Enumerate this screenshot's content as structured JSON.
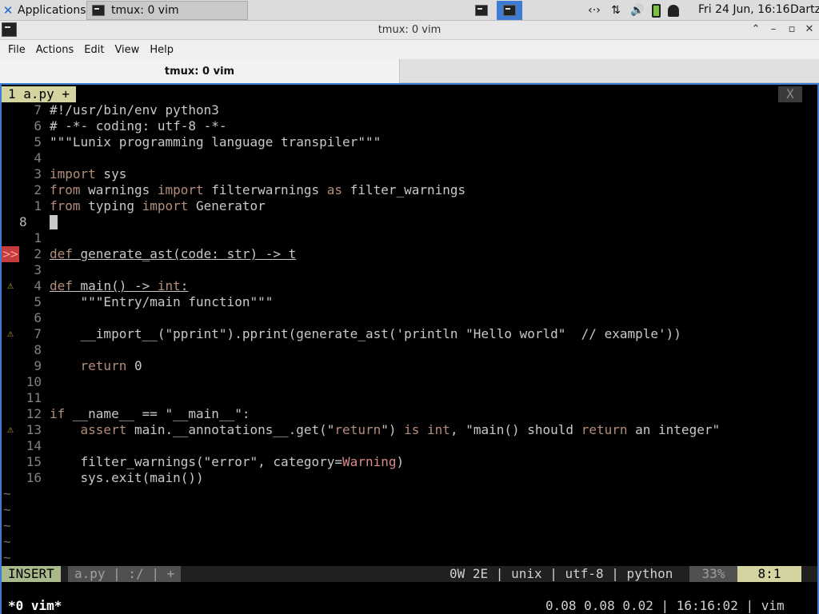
{
  "panel": {
    "apps_label": "Applications",
    "task_label": "tmux: 0 vim",
    "clock": "Fri 24 Jun, 16:16",
    "user": "Dartz",
    "tray_network_glyph": "‹·›",
    "tray_transfer_glyph": "⇅",
    "tray_volume_glyph": "🔊"
  },
  "window": {
    "title": "tmux: 0 vim",
    "min_glyph": "⌃",
    "restore_glyph": "–",
    "max_glyph": "▫",
    "close_glyph": "✕"
  },
  "menu": [
    "File",
    "Actions",
    "Edit",
    "View",
    "Help"
  ],
  "tab": {
    "label": "tmux: 0 vim"
  },
  "vim": {
    "buftab": "1 a.py +",
    "buftab_close": "X",
    "lines": [
      {
        "num": "7",
        "sign": "",
        "code": "#!/usr/bin/env python3"
      },
      {
        "num": "6",
        "sign": "",
        "code": "# -*- coding: utf-8 -*-"
      },
      {
        "num": "5",
        "sign": "",
        "code": "\"\"\"Lunix programming language transpiler\"\"\""
      },
      {
        "num": "4",
        "sign": "",
        "code": ""
      },
      {
        "num": "3",
        "sign": "",
        "code": "import sys"
      },
      {
        "num": "2",
        "sign": "",
        "code": "from warnings import filterwarnings as filter_warnings"
      },
      {
        "num": "1",
        "sign": "",
        "code": "from typing import Generator"
      },
      {
        "num": "8",
        "sign": "",
        "code": "",
        "current": true
      },
      {
        "num": "1",
        "sign": "",
        "code": ""
      },
      {
        "num": "2",
        "sign": ">>",
        "code": "def generate_ast(code: str) -> t"
      },
      {
        "num": "3",
        "sign": "",
        "code": ""
      },
      {
        "num": "4",
        "sign": "⚠",
        "code": "def main() -> int:"
      },
      {
        "num": "5",
        "sign": "",
        "code": "    \"\"\"Entry/main function\"\"\""
      },
      {
        "num": "6",
        "sign": "",
        "code": ""
      },
      {
        "num": "7",
        "sign": "⚠",
        "code": "    __import__(\"pprint\").pprint(generate_ast('println \"Hello world\"  // example'))"
      },
      {
        "num": "8",
        "sign": "",
        "code": ""
      },
      {
        "num": "9",
        "sign": "",
        "code": "    return 0"
      },
      {
        "num": "10",
        "sign": "",
        "code": ""
      },
      {
        "num": "11",
        "sign": "",
        "code": ""
      },
      {
        "num": "12",
        "sign": "",
        "code": "if __name__ == \"__main__\":"
      },
      {
        "num": "13",
        "sign": "⚠",
        "code": "    assert main.__annotations__.get(\"return\") is int, \"main() should return an integer\""
      },
      {
        "num": "14",
        "sign": "",
        "code": ""
      },
      {
        "num": "15",
        "sign": "",
        "code": "    filter_warnings(\"error\", category=Warning)"
      },
      {
        "num": "16",
        "sign": "",
        "code": "    sys.exit(main())"
      }
    ],
    "tildes": [
      "~",
      "~",
      "~",
      "~",
      "~"
    ],
    "status": {
      "mode": "INSERT",
      "file": "a.py | :/ | +",
      "info": "0W 2E | unix | utf-8 | python",
      "percent": "33%",
      "position": "8:1"
    }
  },
  "tmux": {
    "left": "*0 vim*",
    "right": "0.08 0.08 0.02 | 16:16:02 | vim"
  }
}
